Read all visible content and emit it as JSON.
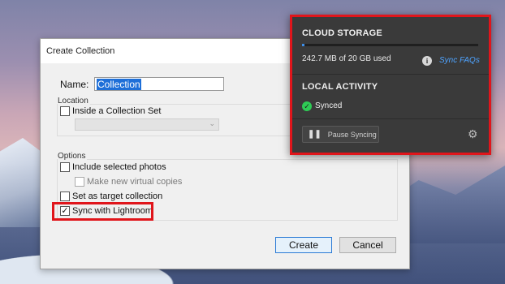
{
  "dialog": {
    "title": "Create Collection",
    "name_label": "Name:",
    "name_value": "Collection",
    "location": {
      "group_label": "Location",
      "inside_set": {
        "label": "Inside a Collection Set",
        "checked": false
      }
    },
    "options": {
      "group_label": "Options",
      "include_selected": {
        "label": "Include selected photos",
        "checked": false
      },
      "virtual_copies": {
        "label": "Make new virtual copies",
        "checked": false,
        "disabled": true
      },
      "target_collection": {
        "label": "Set as target collection",
        "checked": false
      },
      "sync_lightroom": {
        "label": "Sync with Lightroom",
        "checked": true
      }
    },
    "create_label": "Create",
    "cancel_label": "Cancel"
  },
  "cloud": {
    "storage_heading": "CLOUD STORAGE",
    "usage_text": "242.7 MB of 20 GB used",
    "usage_fraction": 0.012,
    "info_glyph": "i",
    "faq_label": "Sync FAQs",
    "local_heading": "LOCAL ACTIVITY",
    "status_glyph": "✓",
    "status_text": "Synced",
    "pause_glyph": "❚❚",
    "pause_label": "Pause Syncing",
    "gear_glyph": "⚙"
  },
  "colors": {
    "highlight": "#e0151b",
    "accent_blue": "#3d8ee8",
    "synced_green": "#2ecc55"
  }
}
